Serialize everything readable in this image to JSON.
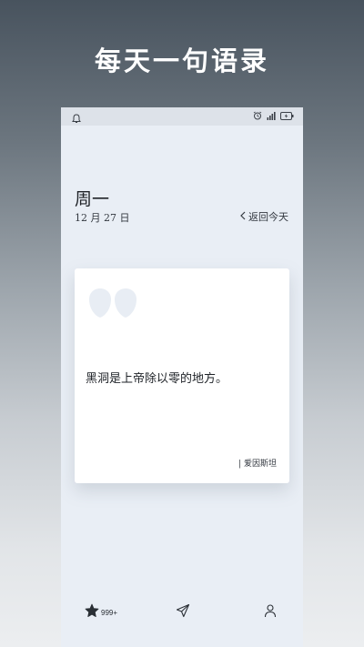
{
  "headline": "每天一句语录",
  "status_bar": {
    "left_icon": "bell-icon",
    "right_icons": [
      "alarm-icon",
      "signal-icon",
      "battery-icon"
    ]
  },
  "header": {
    "weekday": "周一",
    "date": "12 月 27 日",
    "back_today_label": "返回今天"
  },
  "quote_card": {
    "quote_icon": "quote-mark-icon",
    "text": "黑洞是上帝除以零的地方。",
    "author": "| 爱因斯坦"
  },
  "bottom_nav": {
    "favorites_count": "999+",
    "items": [
      "star-icon",
      "send-icon",
      "profile-icon"
    ]
  },
  "colors": {
    "screen_background": "#e9eef5",
    "card_background": "#ffffff",
    "quote_mark": "#e8edf4",
    "text_dark": "#1e2227"
  }
}
